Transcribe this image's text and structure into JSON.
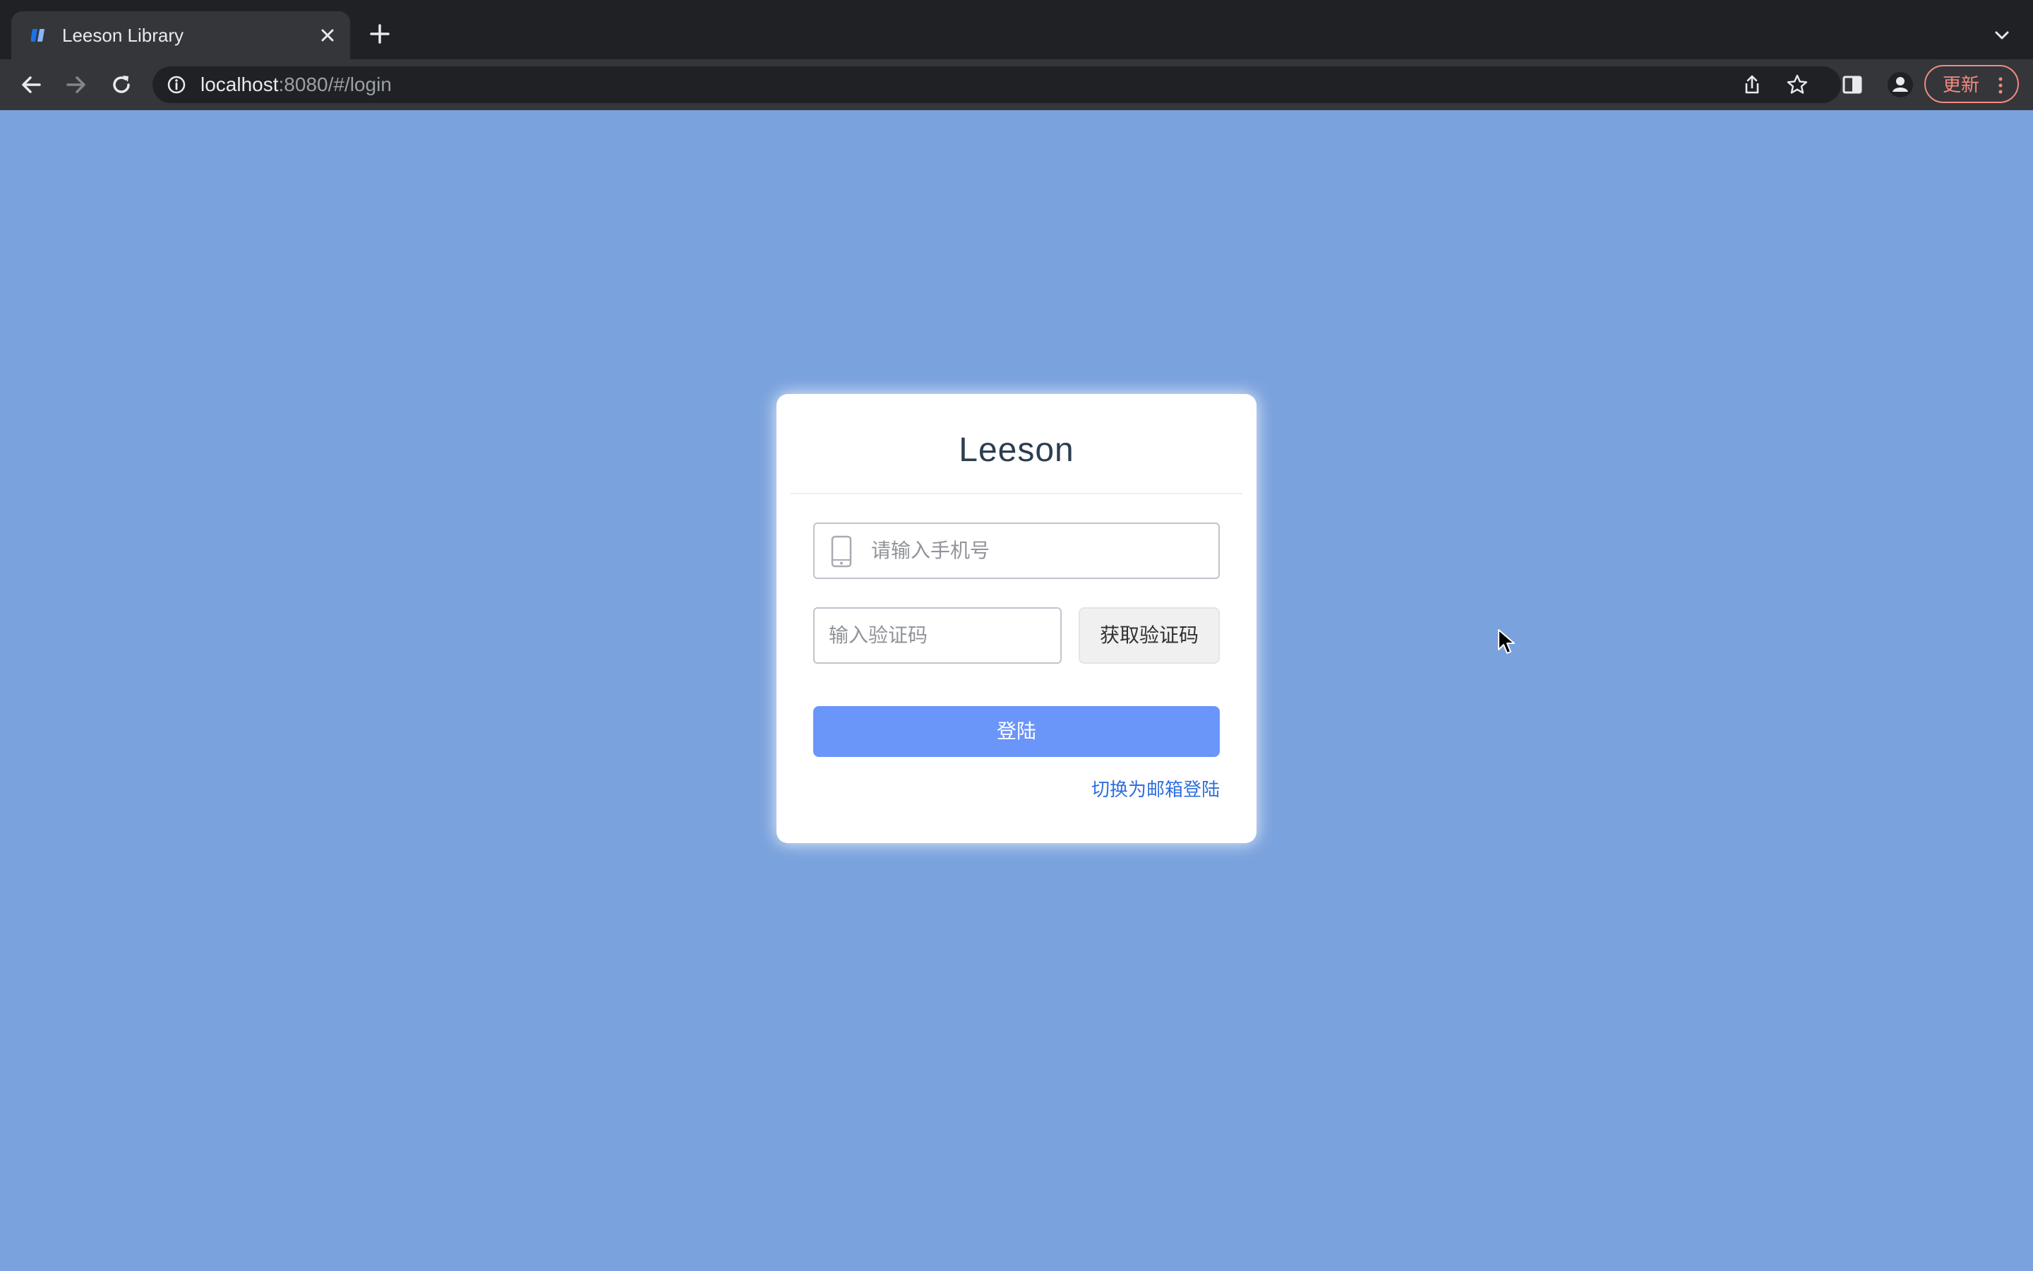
{
  "browser": {
    "tab": {
      "title": "Leeson Library",
      "favicon": "book-icon"
    },
    "url": {
      "host": "localhost",
      "rest": ":8080/#/login"
    },
    "update_button": {
      "label": "更新"
    }
  },
  "login": {
    "title": "Leeson",
    "phone_placeholder": "请输入手机号",
    "code_placeholder": "输入验证码",
    "get_code_label": "获取验证码",
    "submit_label": "登陆",
    "switch_label": "切换为邮箱登陆"
  },
  "colors": {
    "page_background": "#7aa2dd",
    "primary_button": "#6a95f9",
    "link": "#2d6fe0"
  }
}
